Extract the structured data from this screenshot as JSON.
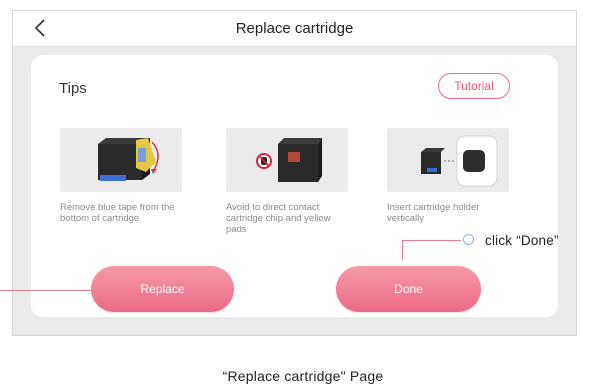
{
  "header": {
    "title": "Replace cartridge"
  },
  "tips": {
    "title": "Tips",
    "tutorial_label": "Tutorial",
    "items": [
      {
        "text": "Remove blue tape from the bottom of cartridge"
      },
      {
        "text": "Avoid to direct contact cartridge chip and yellow pads"
      },
      {
        "text": "Insert cartridge holder vertically"
      }
    ]
  },
  "actions": {
    "replace_label": "Replace",
    "done_label": "Done"
  },
  "annotation": {
    "click_text": "click “Done”",
    "caption": "“Replace cartridge\" Page"
  },
  "colors": {
    "accent": "#ec6a86",
    "accent_light": "#f59aa9",
    "marker": "#8db0e8"
  }
}
